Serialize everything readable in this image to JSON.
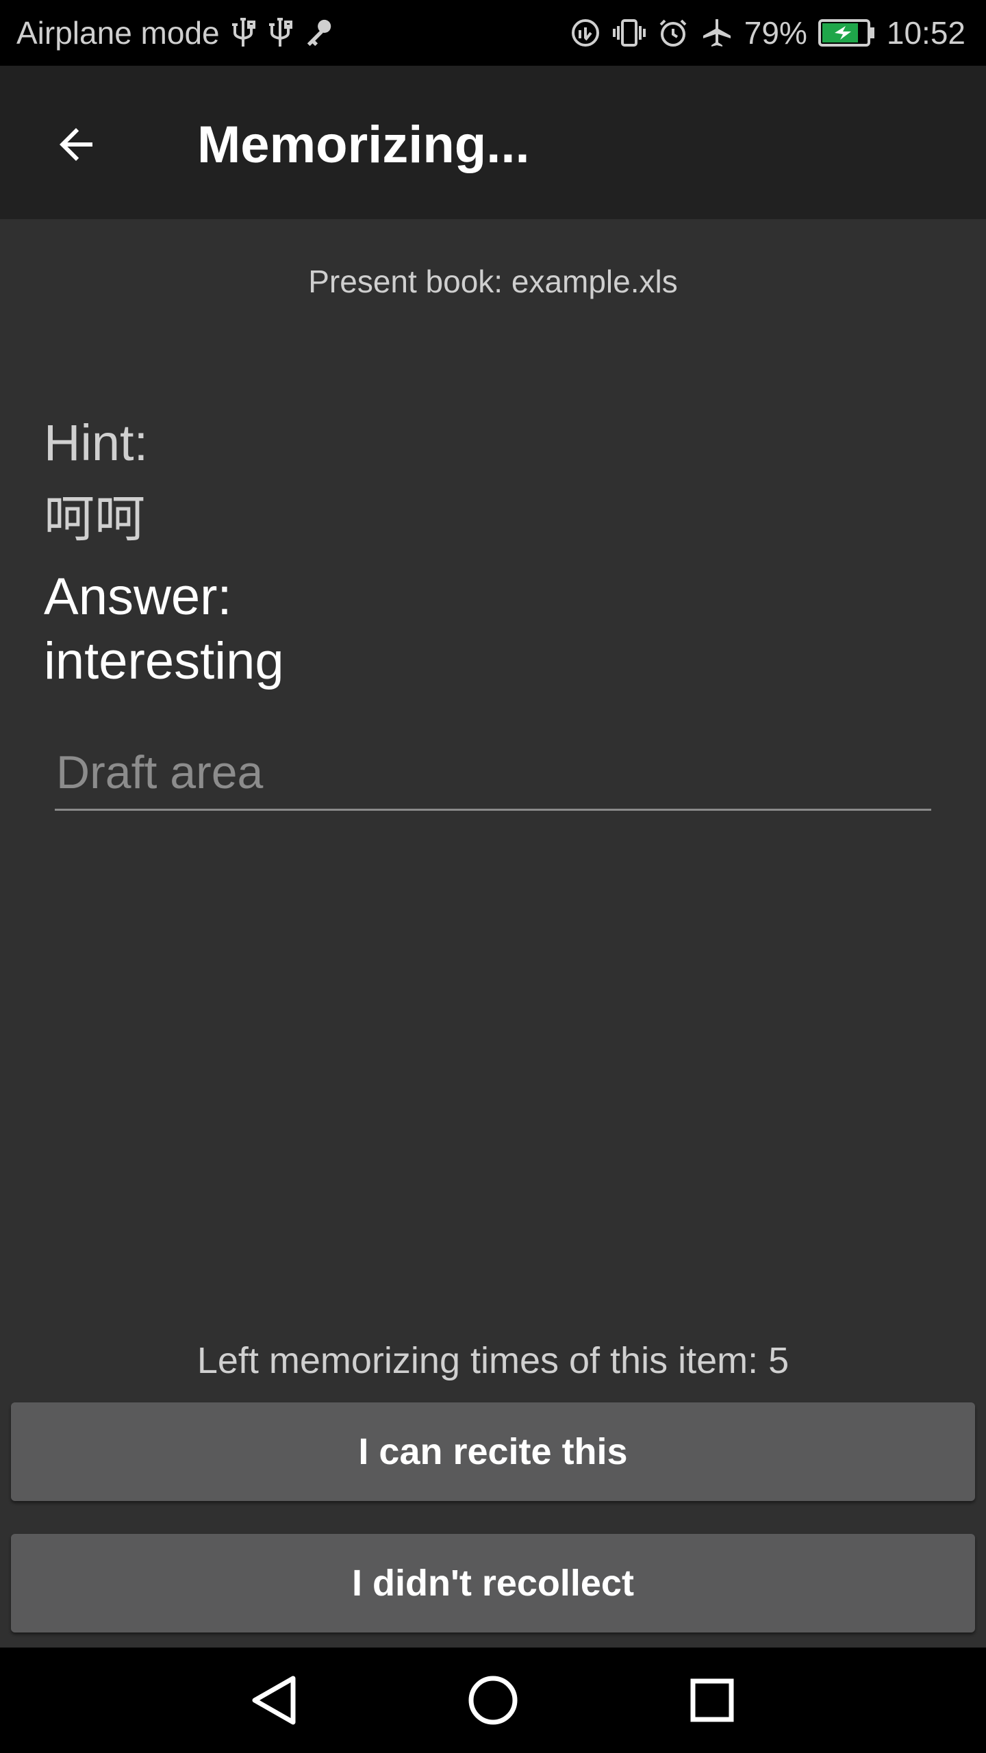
{
  "status_bar": {
    "left_text": "Airplane mode",
    "battery": "79%",
    "time": "10:52",
    "icons_left": [
      "usb-icon",
      "usb-icon",
      "key-icon"
    ],
    "icons_right": [
      "data-saver-icon",
      "vibrate-icon",
      "alarm-icon",
      "airplane-icon",
      "battery-charging-icon"
    ],
    "battery_color": "#1fa64a"
  },
  "app_bar": {
    "title": "Memorizing...",
    "back_icon": "arrow-back-icon"
  },
  "main": {
    "book_line": "Present book: example.xls",
    "hint_label": "Hint:",
    "hint_value": "呵呵",
    "answer_label": "Answer:",
    "answer_value": "interesting",
    "draft_placeholder": "Draft area",
    "draft_value": "",
    "remaining_text": "Left memorizing times of this item: 5"
  },
  "buttons": {
    "recite": "I can recite this",
    "not_recollect": "I didn't recollect"
  },
  "nav_bar": {
    "back": "nav-back-icon",
    "home": "nav-home-icon",
    "recents": "nav-recents-icon"
  },
  "colors": {
    "background": "#303030",
    "app_bar": "#212121",
    "button": "#5a5a5b",
    "status_bar": "#000000"
  }
}
